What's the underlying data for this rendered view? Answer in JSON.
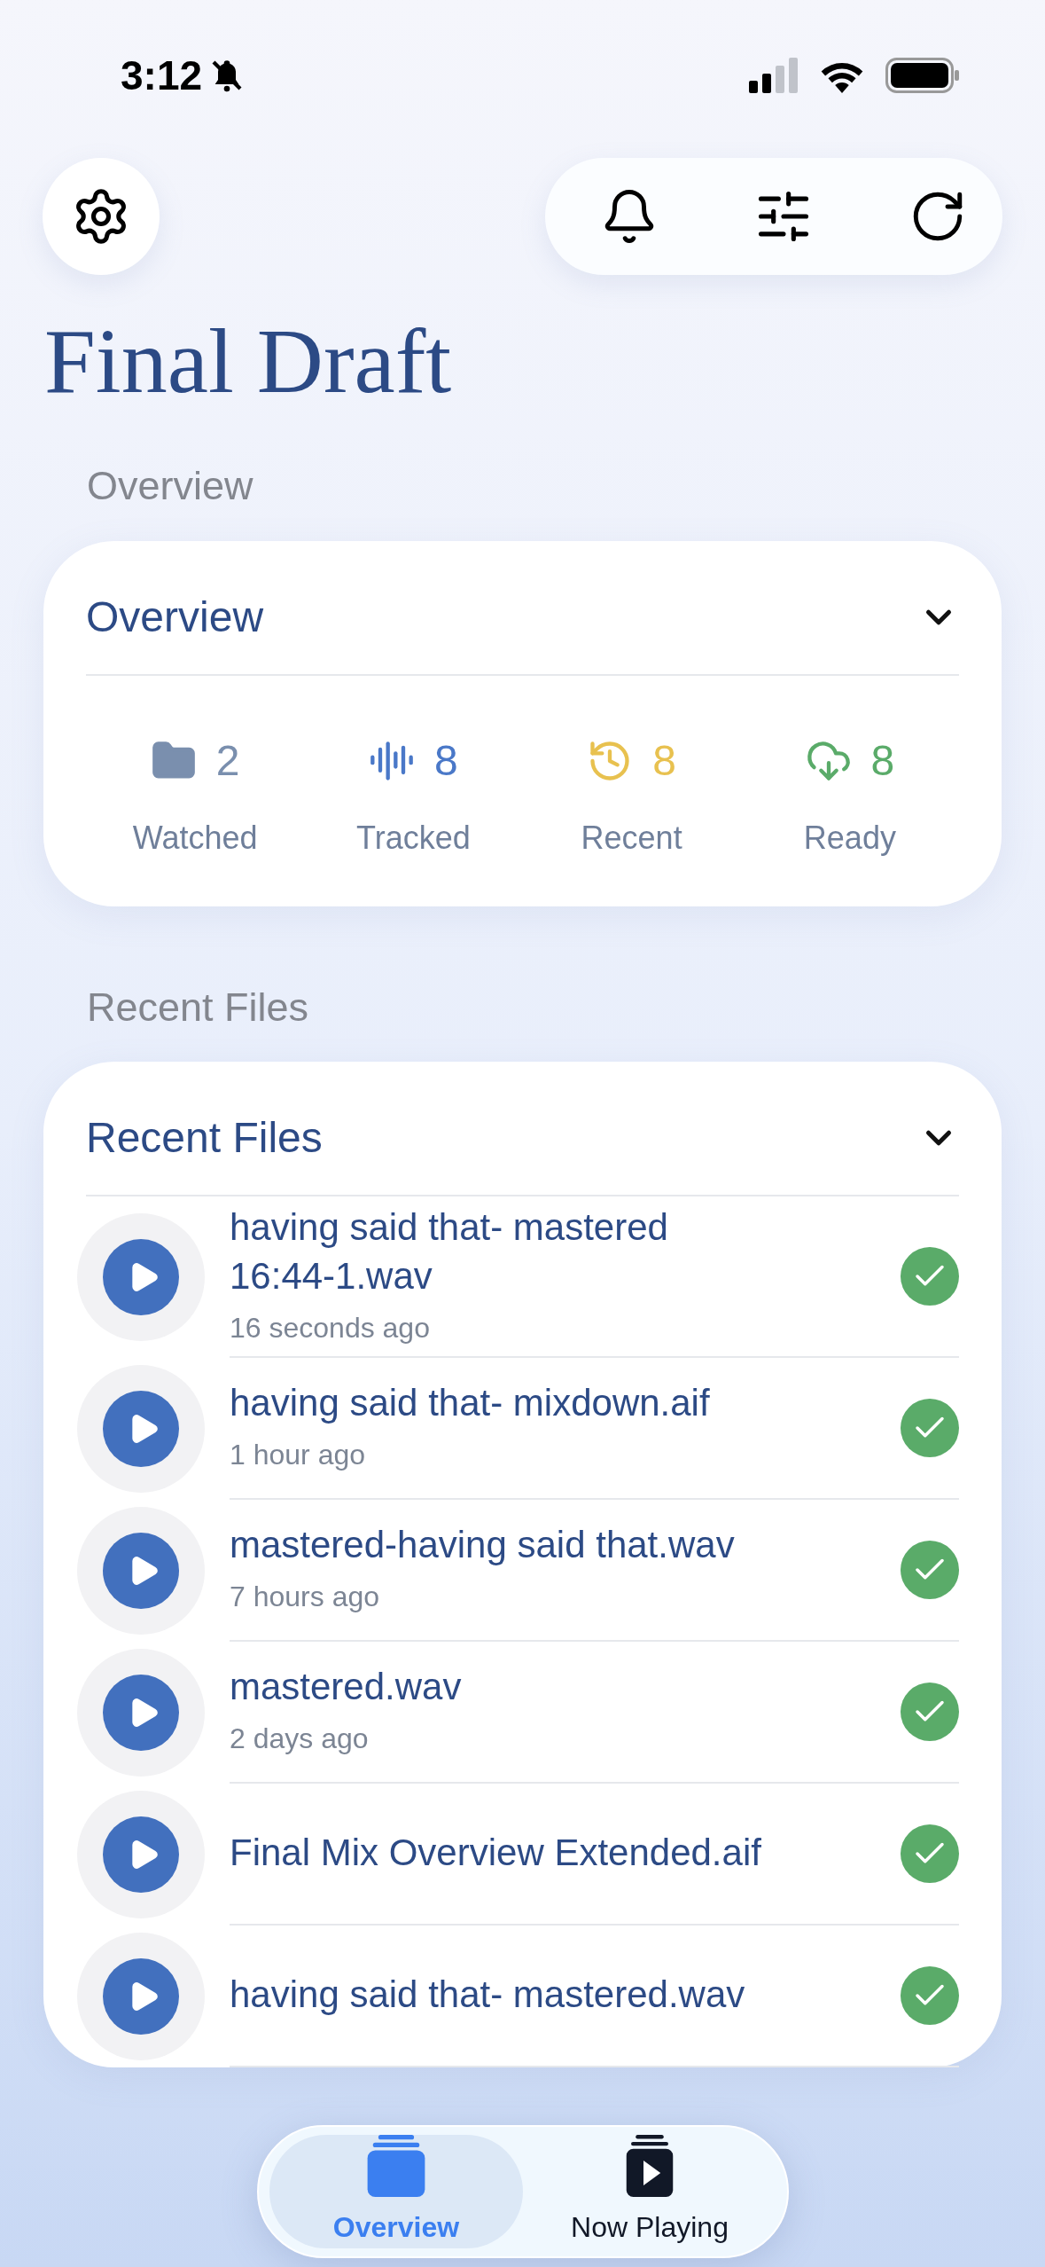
{
  "status_bar": {
    "time": "3:12"
  },
  "title": "Final Draft",
  "overview_section": {
    "label": "Overview",
    "card_title": "Overview",
    "expanded": true,
    "stats": [
      {
        "kind": "folder",
        "value": "2",
        "label": "Watched",
        "color": "#7a8fae"
      },
      {
        "kind": "waveform",
        "value": "8",
        "label": "Tracked",
        "color": "#4a78c8"
      },
      {
        "kind": "history",
        "value": "8",
        "label": "Recent",
        "color": "#e8c14f"
      },
      {
        "kind": "cloud",
        "value": "8",
        "label": "Ready",
        "color": "#5aab69"
      }
    ]
  },
  "recent_section": {
    "label": "Recent Files",
    "card_title": "Recent Files",
    "expanded": true,
    "files": [
      {
        "name": "having said that- mastered 16:44-1.wav",
        "time": "16 seconds ago",
        "done": true
      },
      {
        "name": "having said that- mixdown.aif",
        "time": "1 hour ago",
        "done": true
      },
      {
        "name": "mastered-having said that.wav",
        "time": "7 hours ago",
        "done": true
      },
      {
        "name": "mastered.wav",
        "time": "2 days ago",
        "done": true
      },
      {
        "name": "Final Mix Overview Extended.aif",
        "done": true
      },
      {
        "name": "having said that- mastered.wav",
        "done": true
      }
    ]
  },
  "tab_bar": [
    {
      "kind": "overview",
      "label": "Overview",
      "selected": true
    },
    {
      "kind": "playing",
      "label": "Now Playing",
      "selected": false
    }
  ]
}
